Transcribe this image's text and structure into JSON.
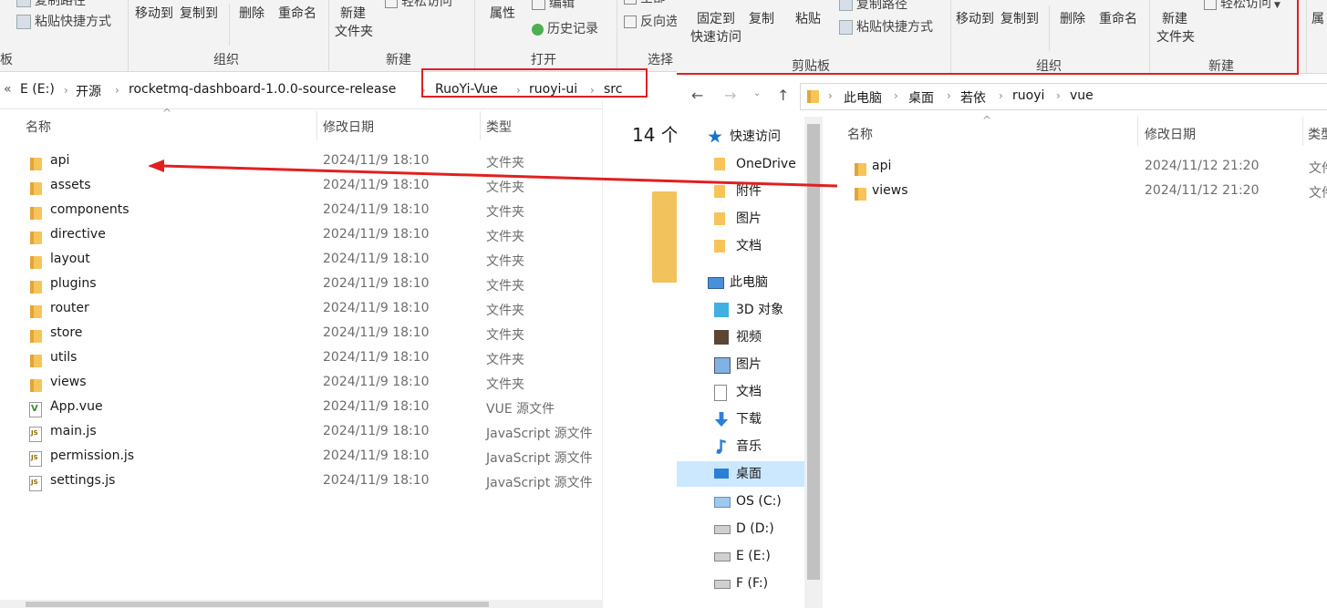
{
  "left": {
    "ribbon": {
      "partial_top1": "复制路径",
      "paste_shortcut": "粘贴快捷方式",
      "move_to": "移动到",
      "copy_to": "复制到",
      "delete": "删除",
      "rename": "重命名",
      "new_folder_line1": "新建",
      "new_folder_line2": "文件夹",
      "easy_access": "轻松访问",
      "properties": "属性",
      "edit": "编辑",
      "history": "历史记录",
      "select_all_partial": "全部",
      "invert_partial": "反向选",
      "groups": {
        "clipboard_partial": "板",
        "organize": "组织",
        "new": "新建",
        "open": "打开",
        "select_partial": "选择"
      }
    },
    "breadcrumb": [
      "«",
      "E (E:)",
      "开源",
      "rocketmq-dashboard-1.0.0-source-release",
      "RuoYi-Vue",
      "ruoyi-ui",
      "src"
    ],
    "headers": {
      "name": "名称",
      "date": "修改日期",
      "type": "类型"
    },
    "item_count": "14 个",
    "files": [
      {
        "name": "api",
        "date": "2024/11/9 18:10",
        "type": "文件夹",
        "kind": "folder"
      },
      {
        "name": "assets",
        "date": "2024/11/9 18:10",
        "type": "文件夹",
        "kind": "folder"
      },
      {
        "name": "components",
        "date": "2024/11/9 18:10",
        "type": "文件夹",
        "kind": "folder"
      },
      {
        "name": "directive",
        "date": "2024/11/9 18:10",
        "type": "文件夹",
        "kind": "folder"
      },
      {
        "name": "layout",
        "date": "2024/11/9 18:10",
        "type": "文件夹",
        "kind": "folder"
      },
      {
        "name": "plugins",
        "date": "2024/11/9 18:10",
        "type": "文件夹",
        "kind": "folder"
      },
      {
        "name": "router",
        "date": "2024/11/9 18:10",
        "type": "文件夹",
        "kind": "folder"
      },
      {
        "name": "store",
        "date": "2024/11/9 18:10",
        "type": "文件夹",
        "kind": "folder"
      },
      {
        "name": "utils",
        "date": "2024/11/9 18:10",
        "type": "文件夹",
        "kind": "folder"
      },
      {
        "name": "views",
        "date": "2024/11/9 18:10",
        "type": "文件夹",
        "kind": "folder"
      },
      {
        "name": "App.vue",
        "date": "2024/11/9 18:10",
        "type": "VUE 源文件",
        "kind": "vue"
      },
      {
        "name": "main.js",
        "date": "2024/11/9 18:10",
        "type": "JavaScript 源文件",
        "kind": "js"
      },
      {
        "name": "permission.js",
        "date": "2024/11/9 18:10",
        "type": "JavaScript 源文件",
        "kind": "js"
      },
      {
        "name": "settings.js",
        "date": "2024/11/9 18:10",
        "type": "JavaScript 源文件",
        "kind": "js"
      }
    ]
  },
  "right": {
    "ribbon": {
      "pin_line1": "固定到",
      "pin_line2": "快速访问",
      "copy": "复制",
      "paste": "粘贴",
      "copy_path": "复制路径",
      "paste_shortcut": "粘贴快捷方式",
      "move_to": "移动到",
      "copy_to": "复制到",
      "delete": "删除",
      "rename": "重命名",
      "new_folder_line1": "新建",
      "new_folder_line2": "文件夹",
      "easy_access": "轻松访问",
      "properties_partial": "属",
      "groups": {
        "clipboard": "剪贴板",
        "organize": "组织",
        "new": "新建"
      }
    },
    "breadcrumb": [
      "此电脑",
      "桌面",
      "若依",
      "ruoyi",
      "vue"
    ],
    "headers": {
      "name": "名称",
      "date": "修改日期",
      "type_partial": "类型"
    },
    "files": [
      {
        "name": "api",
        "date": "2024/11/12 21:20",
        "type_partial": "文件"
      },
      {
        "name": "views",
        "date": "2024/11/12 21:20",
        "type_partial": "文件"
      }
    ],
    "nav": [
      {
        "label": "快速访问",
        "icon": "star-icon",
        "level": 0
      },
      {
        "label": "OneDrive",
        "icon": "folder-icon",
        "level": 1
      },
      {
        "label": "附件",
        "icon": "folder-icon",
        "level": 1
      },
      {
        "label": "图片",
        "icon": "folder-icon",
        "level": 1
      },
      {
        "label": "文档",
        "icon": "folder-icon",
        "level": 1
      },
      {
        "label": "此电脑",
        "icon": "computer-icon",
        "level": 0
      },
      {
        "label": "3D 对象",
        "icon": "cube-icon",
        "level": 1
      },
      {
        "label": "视频",
        "icon": "film-icon",
        "level": 1
      },
      {
        "label": "图片",
        "icon": "picture-icon",
        "level": 1
      },
      {
        "label": "文档",
        "icon": "document-icon",
        "level": 1
      },
      {
        "label": "下载",
        "icon": "download-icon",
        "level": 1
      },
      {
        "label": "音乐",
        "icon": "music-icon",
        "level": 1
      },
      {
        "label": "桌面",
        "icon": "desktop-icon",
        "level": 1,
        "selected": true
      },
      {
        "label": "OS (C:)",
        "icon": "windows-drive-icon",
        "level": 1
      },
      {
        "label": "D (D:)",
        "icon": "drive-icon",
        "level": 1
      },
      {
        "label": "E (E:)",
        "icon": "drive-icon",
        "level": 1
      },
      {
        "label": "F (F:)",
        "icon": "drive-icon",
        "level": 1
      }
    ]
  },
  "annotation": {
    "arrow_color": "#e02020",
    "box_color": "#e02020"
  }
}
